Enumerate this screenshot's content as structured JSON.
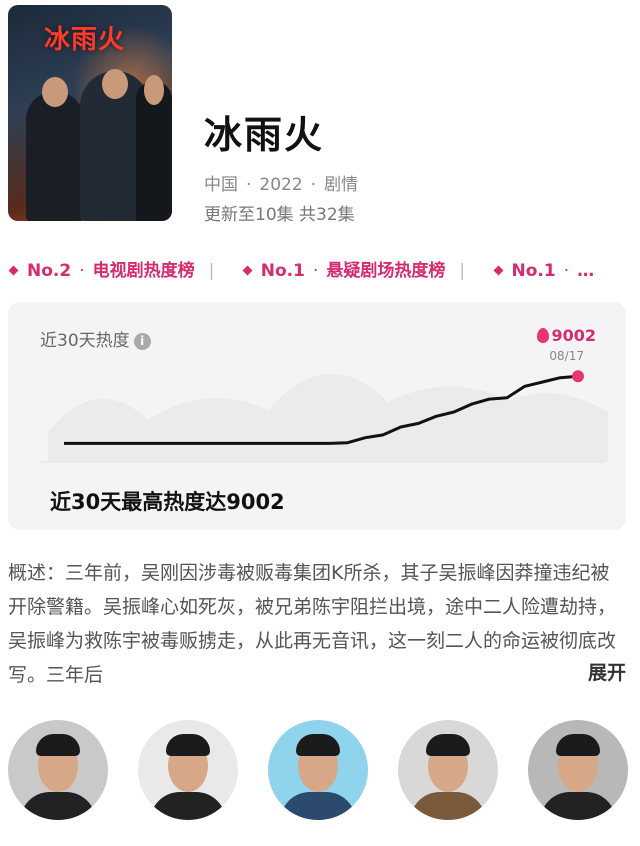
{
  "show": {
    "poster_title": "冰雨火",
    "title": "冰雨火",
    "region": "中国",
    "year": "2022",
    "genre": "剧情",
    "separator": "·",
    "episodes": "更新至10集 共32集"
  },
  "ranks": [
    {
      "no": "No.2",
      "name": "电视剧热度榜"
    },
    {
      "no": "No.1",
      "name": "悬疑剧场热度榜"
    },
    {
      "no": "No.1",
      "name": "…"
    }
  ],
  "heat_card": {
    "label": "近30天热度",
    "info_icon": "i",
    "peak_value": "9002",
    "peak_date": "08/17",
    "summary": "近30天最高热度达9002",
    "line_color": "#111111",
    "marker_color": "#e8366f"
  },
  "chart_data": {
    "type": "line",
    "title": "近30天热度",
    "series": [
      {
        "values": [
          4300,
          4300,
          4300,
          4300,
          4300,
          4300,
          4300,
          4300,
          4300,
          4300,
          4300,
          4300,
          4300,
          4300,
          4300,
          4300,
          4350,
          4700,
          4900,
          5450,
          5700,
          6200,
          6500,
          7050,
          7400,
          7500,
          8300,
          8600,
          8900,
          9002
        ]
      }
    ],
    "ylim": [
      3000,
      10000
    ],
    "grid": false,
    "legend": "none"
  },
  "synopsis": {
    "text": "概述：三年前，吴刚因涉毒被贩毒集团K所杀，其子吴振峰因莽撞违纪被开除警籍。吴振峰心如死灰，被兄弟陈宇阻拦出境，途中二人险遭劫持，吴振峰为救陈宇被毒贩掳走，从此再无音讯，这一刻二人的命运被彻底改写。三年后",
    "expand_label": "展开"
  },
  "cast": [
    {
      "name": "..."
    },
    {
      "name": "..."
    },
    {
      "name": "..."
    },
    {
      "name": "..."
    },
    {
      "name": "..."
    }
  ]
}
